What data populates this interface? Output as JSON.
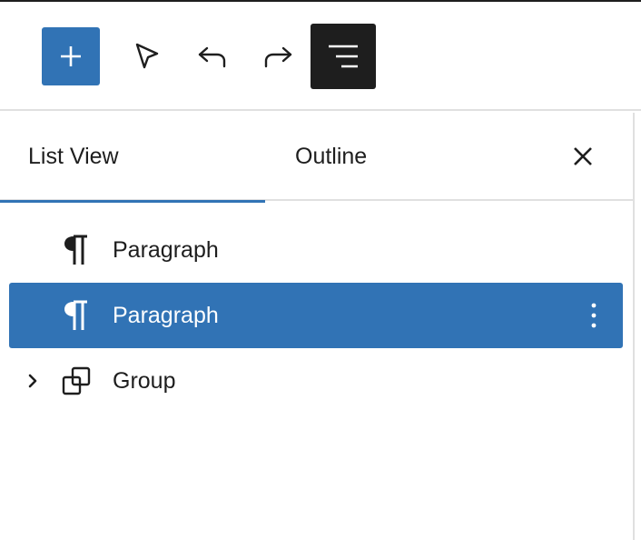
{
  "colors": {
    "accent": "#3173b5",
    "dark": "#1e1e1e"
  },
  "toolbar": {
    "buttons": [
      {
        "name": "add-block",
        "icon": "plus-icon"
      },
      {
        "name": "select-tool",
        "icon": "cursor-arrow-icon"
      },
      {
        "name": "undo",
        "icon": "undo-icon"
      },
      {
        "name": "redo",
        "icon": "redo-icon"
      },
      {
        "name": "document-overview",
        "icon": "list-view-icon",
        "active": true
      }
    ]
  },
  "panel": {
    "tabs": [
      {
        "label": "List View",
        "active": true
      },
      {
        "label": "Outline",
        "active": false
      }
    ],
    "close_icon": "close-icon"
  },
  "tree": {
    "items": [
      {
        "label": "Paragraph",
        "icon": "paragraph-icon",
        "selected": false,
        "expandable": false
      },
      {
        "label": "Paragraph",
        "icon": "paragraph-icon",
        "selected": true,
        "expandable": false,
        "options_icon": "more-vertical-icon"
      },
      {
        "label": "Group",
        "icon": "group-icon",
        "selected": false,
        "expandable": true,
        "expander_icon": "chevron-right-icon"
      }
    ]
  }
}
